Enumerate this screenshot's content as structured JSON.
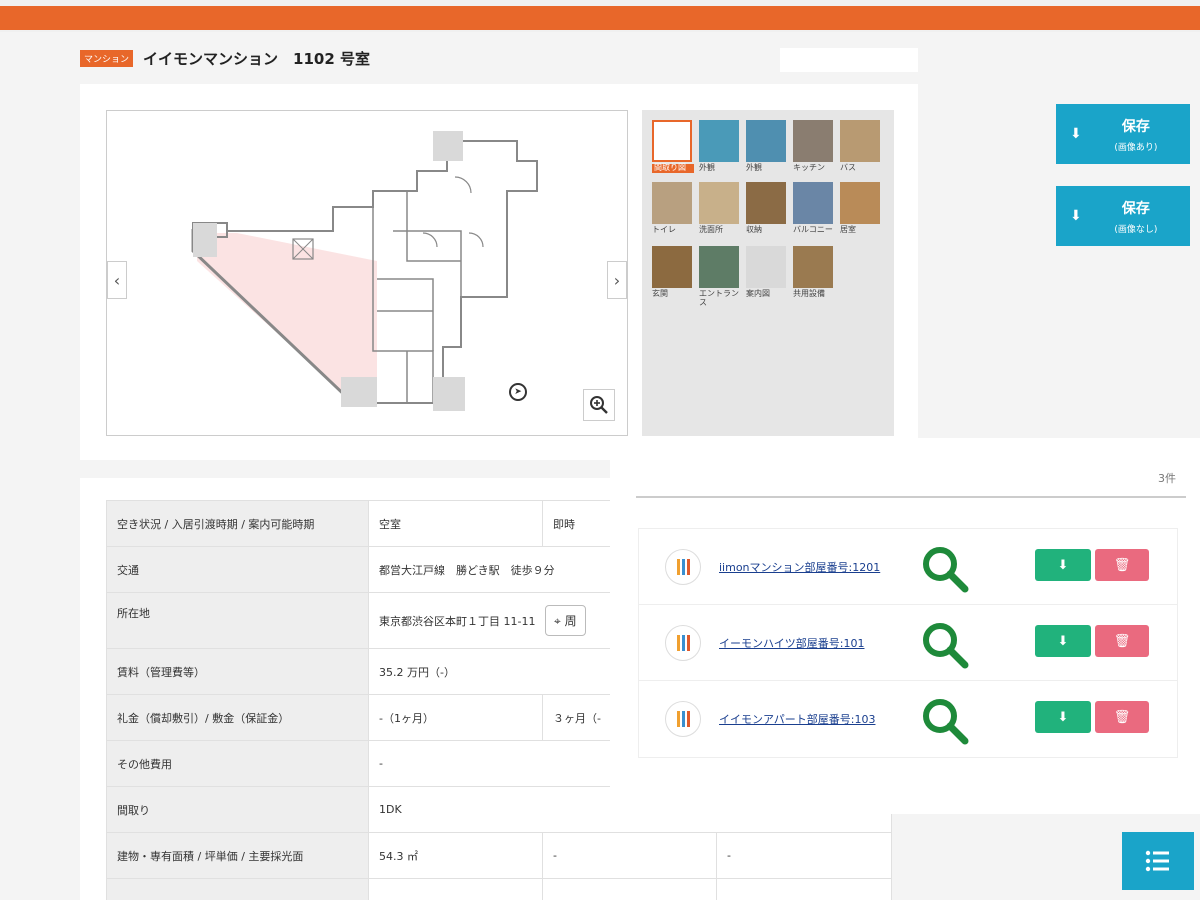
{
  "header": {
    "badge": "マンション",
    "title": "イイモンマンション　1102 号室"
  },
  "floorplan": {
    "prev_icon": "chevron-left-icon",
    "next_icon": "chevron-right-icon",
    "compass_icon": "north-compass-icon",
    "zoom_icon": "zoom-in-icon"
  },
  "thumbnails": [
    {
      "label": "間取り図",
      "color": "#f6e9e6",
      "active": true
    },
    {
      "label": "外観",
      "color": "#4a9ab8",
      "active": false
    },
    {
      "label": "外観",
      "color": "#4f8fb0",
      "active": false
    },
    {
      "label": "キッチン",
      "color": "#8a7d70",
      "active": false
    },
    {
      "label": "バス",
      "color": "#b89a72",
      "active": false
    },
    {
      "label": "トイレ",
      "color": "#b8a080",
      "active": false
    },
    {
      "label": "洗面所",
      "color": "#c8b08a",
      "active": false
    },
    {
      "label": "収納",
      "color": "#8b6b45",
      "active": false
    },
    {
      "label": "バルコニー",
      "color": "#6a86a6",
      "active": false
    },
    {
      "label": "居室",
      "color": "#b98b58",
      "active": false
    },
    {
      "label": "玄関",
      "color": "#8c6a40",
      "active": false
    },
    {
      "label": "エントランス",
      "color": "#5e7c66",
      "active": false
    },
    {
      "label": "案内図",
      "color": "#d9d9d9",
      "active": false
    },
    {
      "label": "共用設備",
      "color": "#9a7a50",
      "active": false
    }
  ],
  "save_buttons": [
    {
      "label": "保存",
      "sub": "(画像あり)",
      "icon": "download-icon"
    },
    {
      "label": "保存",
      "sub": "(画像なし)",
      "icon": "download-icon"
    }
  ],
  "info_rows": [
    {
      "label": "空き状況 / 入居引渡時期 / 案内可能時期",
      "c1": "空室",
      "c2": "即時",
      "c3": ""
    },
    {
      "label": "交通",
      "c1": "都営大江戸線　勝どき駅　徒歩９分",
      "c2": "",
      "c3": ""
    },
    {
      "label": "所在地",
      "c1": "東京都渋谷区本町１丁目 11-11",
      "c2": "",
      "c3": ""
    },
    {
      "label": "賃料（管理費等）",
      "c1": "35.2 万円（-）",
      "c2": "",
      "c3": ""
    },
    {
      "label": "礼金（償却敷引）/ 敷金（保証金）",
      "c1": "-（1ヶ月）",
      "c2": "３ヶ月（-",
      "c3": ""
    },
    {
      "label": "その他費用",
      "c1": "-",
      "c2": "",
      "c3": ""
    },
    {
      "label": "間取り",
      "c1": "1DK",
      "c2": "",
      "c3": ""
    },
    {
      "label": "建物・専有面積 / 坪単価 / 主要採光面",
      "c1": "54.3 ㎡",
      "c2": "-",
      "c3": "-"
    },
    {
      "label": "",
      "c1": "",
      "c2": "",
      "c3": ""
    }
  ],
  "location_button_icon": "map-pin-icon",
  "location_button_text": "周",
  "results": {
    "count": "3件",
    "items": [
      {
        "name": "iimonマンション部屋番号:1201"
      },
      {
        "name": "イーモンハイツ部屋番号:101"
      },
      {
        "name": "イイモンアパート部屋番号:103"
      }
    ]
  },
  "list_toggle_icon": "list-icon",
  "colors": {
    "brand_orange": "#e8672a",
    "accent_blue": "#1aa4c9",
    "download_green": "#21b27c",
    "delete_red": "#ea6a7f",
    "magnifier_green": "#1e8a3a"
  }
}
